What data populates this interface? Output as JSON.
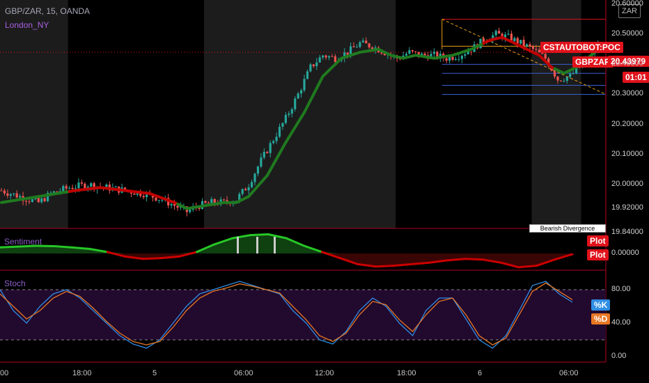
{
  "header": {
    "symbol": "GBP/ZAR, 15, OANDA",
    "session": "London_NY",
    "currency": "ZAR"
  },
  "tags": {
    "poc": "CSTAUTOBOT:POC",
    "symbol": "GBPZAR",
    "price": "20.43979",
    "countdown": "01:01",
    "tooltip": "Bearish Divergence",
    "plot1": "Plot",
    "plot2": "Plot",
    "k": "%K",
    "d": "%D"
  },
  "panes": {
    "sentiment": "Sentiment",
    "stoch": "Stoch"
  },
  "colors": {
    "up": "#26a69a",
    "down": "#ef5350",
    "ma_up": "#1f7a1f",
    "ma_down": "#c00000",
    "session_bg": "#1c1c1c",
    "stoch_bg": "#22092e",
    "k_line": "#2f8de4",
    "d_line": "#e87724",
    "sent_up": "#27c727",
    "sent_down": "#cc0000"
  },
  "chart_data": [
    {
      "type": "candlestick",
      "title": "GBP/ZAR, 15, OANDA",
      "price_axis": [
        "20.60000",
        "20.50000",
        "20.40000",
        "20.30000",
        "20.20000",
        "20.10000",
        "20.00000",
        "19.92000",
        "19.84000"
      ],
      "ylim": [
        19.84,
        20.6
      ],
      "current_price": 20.43979,
      "time_axis": [
        "00",
        "18:00",
        "5",
        "06:00",
        "12:00",
        "18:00",
        "6",
        "06:00"
      ],
      "price_path": [
        [
          0,
          19.98
        ],
        [
          3,
          19.96
        ],
        [
          6,
          19.94
        ],
        [
          8,
          19.97
        ],
        [
          11,
          19.99
        ],
        [
          14,
          20.0
        ],
        [
          17,
          19.99
        ],
        [
          20,
          19.98
        ],
        [
          23,
          19.97
        ],
        [
          26,
          19.95
        ],
        [
          28,
          19.93
        ],
        [
          30,
          19.91
        ],
        [
          32,
          19.93
        ],
        [
          34,
          19.94
        ],
        [
          36,
          19.94
        ],
        [
          38,
          19.95
        ],
        [
          40,
          20.0
        ],
        [
          42,
          20.08
        ],
        [
          44,
          20.15
        ],
        [
          46,
          20.22
        ],
        [
          48,
          20.3
        ],
        [
          50,
          20.39
        ],
        [
          52,
          20.43
        ],
        [
          54,
          20.42
        ],
        [
          56,
          20.44
        ],
        [
          58,
          20.47
        ],
        [
          60,
          20.46
        ],
        [
          62,
          20.44
        ],
        [
          64,
          20.42
        ],
        [
          66,
          20.44
        ],
        [
          68,
          20.43
        ],
        [
          70,
          20.43
        ],
        [
          72,
          20.42
        ],
        [
          74,
          20.43
        ],
        [
          76,
          20.45
        ],
        [
          78,
          20.48
        ],
        [
          80,
          20.5
        ],
        [
          82,
          20.49
        ],
        [
          84,
          20.47
        ],
        [
          86,
          20.45
        ],
        [
          88,
          20.42
        ],
        [
          90,
          20.35
        ],
        [
          92,
          20.36
        ],
        [
          94,
          20.4
        ],
        [
          96,
          20.44
        ],
        [
          97,
          20.48
        ]
      ],
      "ma_path": [
        [
          0,
          19.94
        ],
        [
          6,
          19.96
        ],
        [
          12,
          19.98
        ],
        [
          16,
          19.99
        ],
        [
          20,
          19.98
        ],
        [
          24,
          19.97
        ],
        [
          28,
          19.94
        ],
        [
          30,
          19.92
        ],
        [
          33,
          19.93
        ],
        [
          36,
          19.94
        ],
        [
          38,
          19.94
        ],
        [
          40,
          19.96
        ],
        [
          43,
          20.03
        ],
        [
          46,
          20.14
        ],
        [
          49,
          20.24
        ],
        [
          52,
          20.36
        ],
        [
          55,
          20.42
        ],
        [
          58,
          20.44
        ],
        [
          61,
          20.45
        ],
        [
          63,
          20.43
        ],
        [
          65,
          20.42
        ],
        [
          67,
          20.43
        ],
        [
          70,
          20.42
        ],
        [
          73,
          20.43
        ],
        [
          76,
          20.45
        ],
        [
          79,
          20.48
        ],
        [
          81,
          20.49
        ],
        [
          84,
          20.46
        ],
        [
          87,
          20.43
        ],
        [
          89,
          20.39
        ],
        [
          91,
          20.37
        ],
        [
          93,
          20.39
        ],
        [
          96,
          20.44
        ]
      ],
      "ma_down_segments": [
        [
          11,
          28
        ],
        [
          78,
          89
        ]
      ],
      "session_shading": [
        [
          0,
          11
        ],
        [
          33,
          64
        ],
        [
          86,
          94
        ]
      ],
      "horizontal_levels": [
        20.55,
        20.46,
        20.4,
        20.37,
        20.33,
        20.3
      ]
    },
    {
      "type": "area",
      "title": "Sentiment",
      "y_axis": [
        "0.00000"
      ],
      "values": [
        0.4,
        0.45,
        0.5,
        0.48,
        0.4,
        0.3,
        0.1,
        -0.2,
        -0.35,
        -0.3,
        -0.2,
        0.1,
        0.6,
        1.0,
        1.2,
        1.25,
        1.0,
        0.5,
        0.1,
        -0.3,
        -0.7,
        -0.85,
        -0.8,
        -0.7,
        -0.6,
        -0.45,
        -0.35,
        -0.4,
        -0.6,
        -0.9,
        -0.8,
        -0.4,
        -0.05
      ]
    },
    {
      "type": "line",
      "title": "Stoch",
      "y_axis": [
        "80.00",
        "40.00",
        "0.00"
      ],
      "ylim": [
        -5,
        100
      ],
      "bands": [
        20,
        80
      ],
      "series": [
        {
          "name": "%K",
          "values": [
            80,
            55,
            40,
            60,
            75,
            80,
            70,
            55,
            40,
            25,
            15,
            10,
            20,
            40,
            60,
            75,
            80,
            85,
            90,
            85,
            80,
            75,
            55,
            40,
            20,
            15,
            30,
            55,
            70,
            60,
            40,
            25,
            55,
            70,
            70,
            45,
            20,
            10,
            25,
            55,
            85,
            90,
            75,
            65
          ]
        },
        {
          "name": "%D",
          "values": [
            75,
            60,
            45,
            55,
            70,
            78,
            72,
            58,
            42,
            28,
            18,
            14,
            18,
            35,
            55,
            70,
            78,
            82,
            87,
            84,
            80,
            76,
            60,
            44,
            25,
            18,
            28,
            50,
            66,
            62,
            44,
            30,
            50,
            66,
            70,
            50,
            25,
            14,
            22,
            50,
            78,
            88,
            78,
            68
          ]
        }
      ]
    }
  ]
}
